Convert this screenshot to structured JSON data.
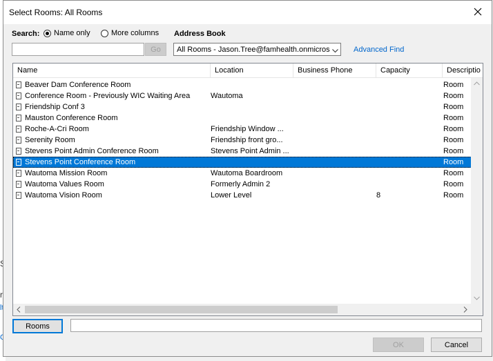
{
  "window": {
    "title": "Select Rooms: All Rooms"
  },
  "search": {
    "label": "Search:",
    "option_name_only": "Name only",
    "option_more_columns": "More columns",
    "selected": "Name only",
    "input_value": "",
    "go_label": "Go"
  },
  "address_book": {
    "label": "Address Book",
    "selected": "All Rooms - Jason.Tree@famhealth.onmicrosoft.com",
    "advanced_find": "Advanced Find"
  },
  "columns": [
    "Name",
    "Location",
    "Business Phone",
    "Capacity",
    "Descriptio"
  ],
  "rows": [
    {
      "name": "Beaver Dam Conference Room",
      "location": "",
      "phone": "",
      "capacity": "",
      "description": "Room",
      "selected": false
    },
    {
      "name": "Conference Room - Previously WIC Waiting Area",
      "location": "Wautoma",
      "phone": "",
      "capacity": "",
      "description": "Room",
      "selected": false
    },
    {
      "name": "Friendship Conf 3",
      "location": "",
      "phone": "",
      "capacity": "",
      "description": "Room",
      "selected": false
    },
    {
      "name": "Mauston Conference Room",
      "location": "",
      "phone": "",
      "capacity": "",
      "description": "Room",
      "selected": false
    },
    {
      "name": "Roche-A-Cri Room",
      "location": "Friendship Window ...",
      "phone": "",
      "capacity": "",
      "description": "Room",
      "selected": false
    },
    {
      "name": "Serenity Room",
      "location": "Friendship front gro...",
      "phone": "",
      "capacity": "",
      "description": "Room",
      "selected": false
    },
    {
      "name": "Stevens Point Admin Conference Room",
      "location": "Stevens Point Admin ...",
      "phone": "",
      "capacity": "",
      "description": "Room",
      "selected": false
    },
    {
      "name": "Stevens Point Conference Room",
      "location": "",
      "phone": "",
      "capacity": "",
      "description": "Room",
      "selected": true
    },
    {
      "name": "Wautoma Mission Room",
      "location": "Wautoma Boardroom",
      "phone": "",
      "capacity": "",
      "description": "Room",
      "selected": false
    },
    {
      "name": "Wautoma Values Room",
      "location": "Formerly Admin 2",
      "phone": "",
      "capacity": "",
      "description": "Room",
      "selected": false
    },
    {
      "name": "Wautoma Vision Room",
      "location": "Lower Level",
      "phone": "",
      "capacity": "8",
      "description": "Room",
      "selected": false
    }
  ],
  "footer": {
    "rooms_button": "Rooms",
    "rooms_field_value": "",
    "ok_label": "OK",
    "cancel_label": "Cancel"
  },
  "background_fragments": [
    "S",
    "r",
    "lt",
    "C"
  ],
  "colors": {
    "selection": "#0078d7",
    "link": "#0066cc"
  },
  "icons": [
    "close-icon",
    "dropdown-arrow-icon",
    "room-icon",
    "scroll-up-icon",
    "scroll-down-icon",
    "scroll-left-icon",
    "scroll-right-icon"
  ]
}
